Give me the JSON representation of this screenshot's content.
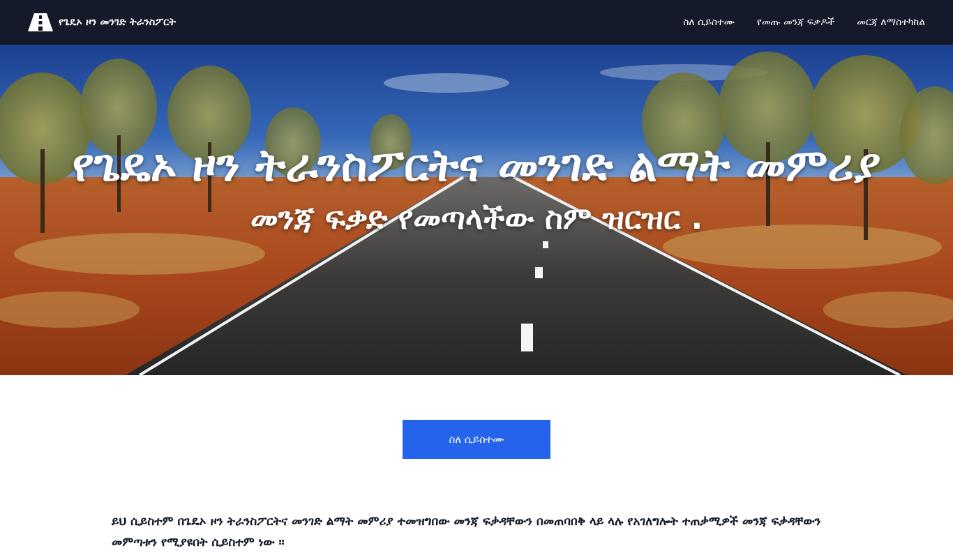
{
  "navbar": {
    "brand_icon": "road-icon",
    "brand_name": "የጌዴኦ ዞን መንገድ ትራንስፖርት",
    "links": [
      {
        "label": "ስለ ሲይስተሙ"
      },
      {
        "label": "የመጡ መንጃ ፍቃዶች"
      },
      {
        "label": "መርጃ ለማስተካከል"
      }
    ],
    "background": "#141a2a"
  },
  "hero": {
    "title": "የጌዴኦ ዞን ትራንስፖርትና መንገድ ልማት መምሪያ",
    "subtitle": "መንጃ ፍቃድ የመጣላችው ስም ዝርዝር ."
  },
  "content": {
    "button_label": "ስለ ሲይስተሙ",
    "button_color": "#2563eb",
    "description": "ይህ ሲይስተም በጌዴኦ ዞን ትራንስፖርትና መንገድ ልማት መምሪያ ተመዝግበው መንጃ ፍቃዳቸውን በመጠባበቅ ላይ ላሉ የአገለግሎት ተጠቃሚዎች መንጃ ፍቃዳቸውን መምጣቱን የሚያዩበት ሲይስተም ነው ።"
  }
}
